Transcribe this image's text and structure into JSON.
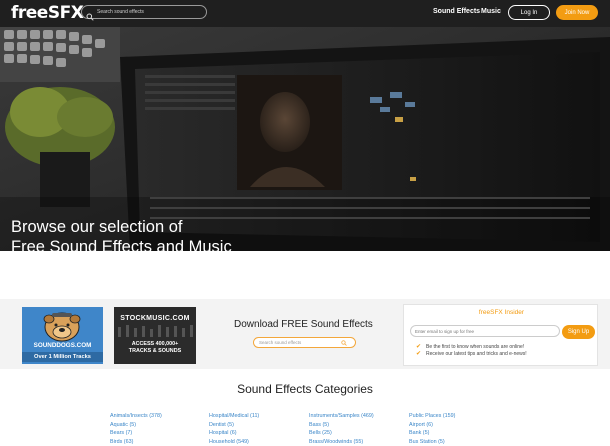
{
  "header": {
    "logo": "freeSFX",
    "search_placeholder": "Search sound effects",
    "nav": [
      "Sound Effects",
      "Music"
    ],
    "login_label": "Log In",
    "join_label": "Join Now"
  },
  "hero": {
    "title_line1": "Browse our selection of",
    "title_line2": "Free Sound Effects and Music"
  },
  "ads": {
    "sounddogs": {
      "line1": "SOUNDDOGS.COM",
      "line2": "Over 1 Million Tracks"
    },
    "stockmusic": {
      "title": "STOCKMUSIC.COM",
      "line1": "ACCESS 400,000+",
      "line2": "TRACKS & SOUNDS"
    }
  },
  "download": {
    "title": "Download FREE Sound Effects",
    "search_placeholder": "Search sound effects"
  },
  "insider": {
    "title": "freeSFX Insider",
    "email_placeholder": "Enter email to sign up for free",
    "signup_label": "Sign Up",
    "bullets": [
      "Be the first to know when sounds are online!",
      "Receive our latest tips and tricks and e-news!"
    ]
  },
  "categories": {
    "title": "Sound Effects Categories",
    "columns": [
      [
        "Animals/Insects (378)",
        "Aquatic (5)",
        "Bears (7)",
        "Birds (63)"
      ],
      [
        "Hospital/Medical (11)",
        "Dentist (5)",
        "Hospital (6)",
        "Household (549)"
      ],
      [
        "Instruments/Samples (469)",
        "Bass (5)",
        "Bells (25)",
        "Brass/Woodwinds (55)"
      ],
      [
        "Public Places (159)",
        "Airport (6)",
        "Bank (5)",
        "Bus Station (5)"
      ]
    ]
  },
  "colors": {
    "accent": "#f39c12",
    "link": "#3a86c8",
    "header_bg": "#1f1f1f"
  }
}
